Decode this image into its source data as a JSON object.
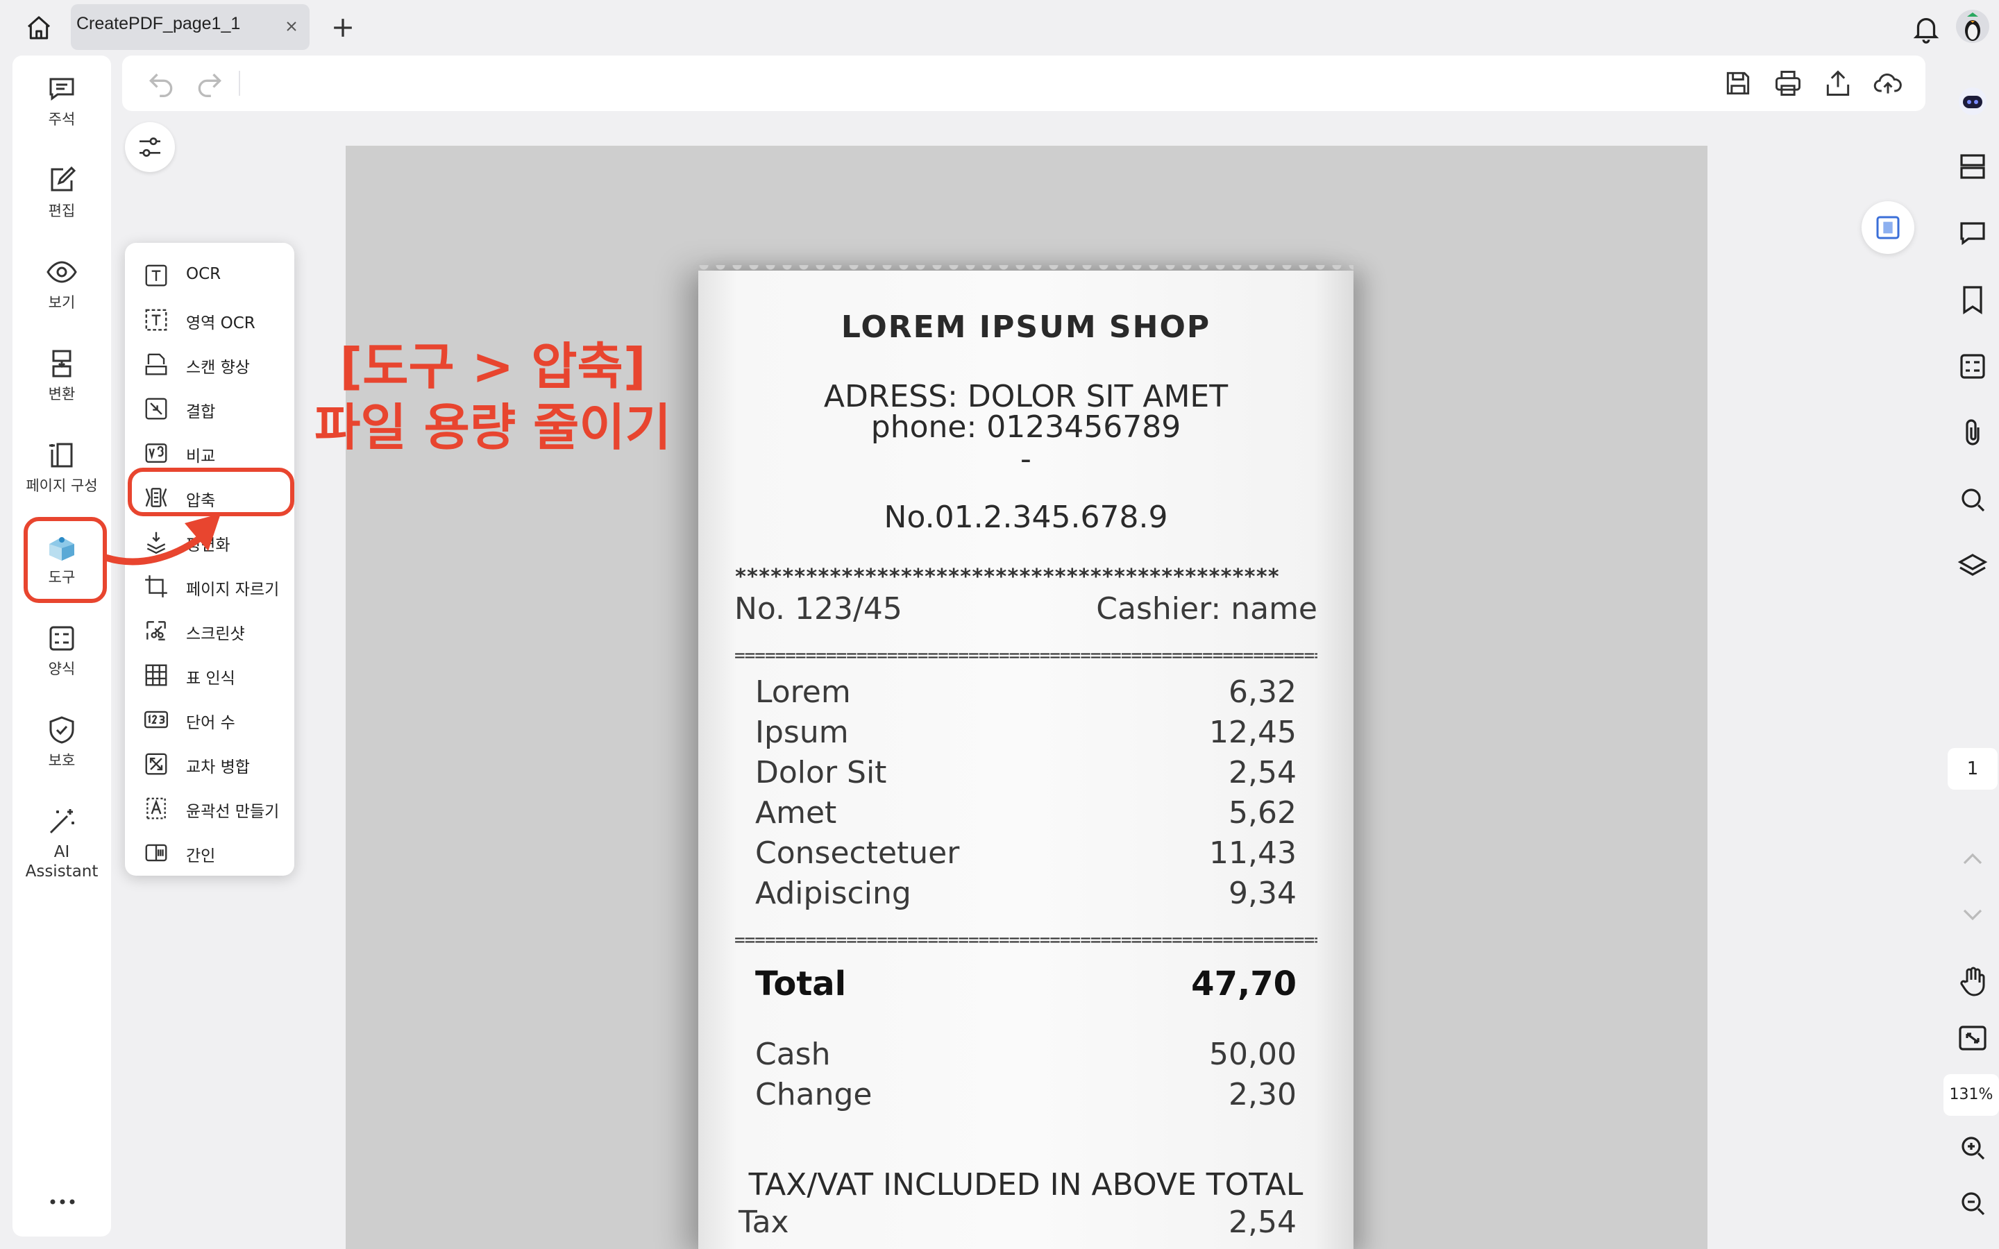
{
  "tab": {
    "title": "CreatePDF_page1_1"
  },
  "left_nav": [
    {
      "label": "주석",
      "icon": "comment-icon"
    },
    {
      "label": "편집",
      "icon": "edit-icon"
    },
    {
      "label": "보기",
      "icon": "eye-icon"
    },
    {
      "label": "변환",
      "icon": "convert-icon"
    },
    {
      "label": "페이지 구성",
      "icon": "page-organize-icon"
    },
    {
      "label": "도구",
      "icon": "toolbox-icon"
    },
    {
      "label": "양식",
      "icon": "form-icon"
    },
    {
      "label": "보호",
      "icon": "shield-icon"
    },
    {
      "label": "AI\nAssistant",
      "icon": "magic-wand-icon"
    }
  ],
  "tools_menu": [
    {
      "label": "OCR",
      "icon": "ocr-icon"
    },
    {
      "label": "영역 OCR",
      "icon": "area-ocr-icon"
    },
    {
      "label": "스캔 향상",
      "icon": "scan-enhance-icon"
    },
    {
      "label": "결합",
      "icon": "combine-icon"
    },
    {
      "label": "비교",
      "icon": "compare-icon"
    },
    {
      "label": "압축",
      "icon": "compress-icon"
    },
    {
      "label": "평면화",
      "icon": "flatten-icon"
    },
    {
      "label": "페이지 자르기",
      "icon": "crop-icon"
    },
    {
      "label": "스크린샷",
      "icon": "screenshot-icon"
    },
    {
      "label": "표 인식",
      "icon": "table-recognize-icon"
    },
    {
      "label": "단어 수",
      "icon": "word-count-icon"
    },
    {
      "label": "교차 병합",
      "icon": "cross-merge-icon"
    },
    {
      "label": "윤곽선 만들기",
      "icon": "outline-icon"
    },
    {
      "label": "간인",
      "icon": "seal-icon"
    }
  ],
  "annotation": {
    "line1": "[도구 > 압축]",
    "line2": "파일 용량 줄이기"
  },
  "receipt": {
    "shop": "LOREM IPSUM SHOP",
    "address": "ADRESS: DOLOR SIT AMET",
    "phone": "phone: 0123456789",
    "dash": "-",
    "number": "No.01.2.345.678.9",
    "stars": "**********************************************",
    "order_no": "No. 123/45",
    "cashier": "Cashier: name",
    "separator": "===========================================================",
    "items": [
      {
        "name": "Lorem",
        "price": "6,32"
      },
      {
        "name": "Ipsum",
        "price": "12,45"
      },
      {
        "name": "Dolor Sit",
        "price": "2,54"
      },
      {
        "name": "Amet",
        "price": "5,62"
      },
      {
        "name": "Consectetuer",
        "price": "11,43"
      },
      {
        "name": "Adipiscing",
        "price": "9,34"
      }
    ],
    "total_label": "Total",
    "total": "47,70",
    "cash_label": "Cash",
    "cash": "50,00",
    "change_label": "Change",
    "change": "2,30",
    "tax_note": "TAX/VAT INCLUDED IN ABOVE TOTAL",
    "tax_label": "Tax",
    "tax": "2,54"
  },
  "page_number": "1",
  "zoom": "131%",
  "colors": {
    "accent": "#e8452f",
    "icon": "#333333",
    "panel": "#ffffff",
    "background": "#f0f0f2",
    "doc": "#cecece"
  }
}
